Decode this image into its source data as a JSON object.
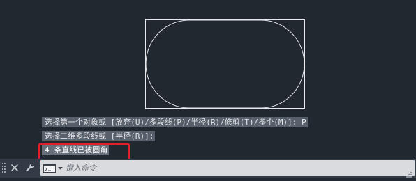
{
  "command_history": [
    {
      "text": "选择第一个对象或 [放弃(U)/多段线(P)/半径(R)/修剪(T)/多个(M)]: P"
    },
    {
      "text": "选择二维多段线或 [半径(R)]:"
    }
  ],
  "command_result": {
    "text": "4 条直线已被圆角"
  },
  "command_line": {
    "placeholder": "键入命令",
    "value": ""
  },
  "toolbar": {
    "close_icon": "close-icon",
    "customize_icon": "wrench-icon",
    "prompt_icon": "command-prompt-icon"
  },
  "colors": {
    "canvas_bg": "#212830",
    "geometry": "#ffffff",
    "highlight_border": "#e0202a",
    "command_bar_bg": "#333b46",
    "input_bg": "#d9dbde"
  }
}
